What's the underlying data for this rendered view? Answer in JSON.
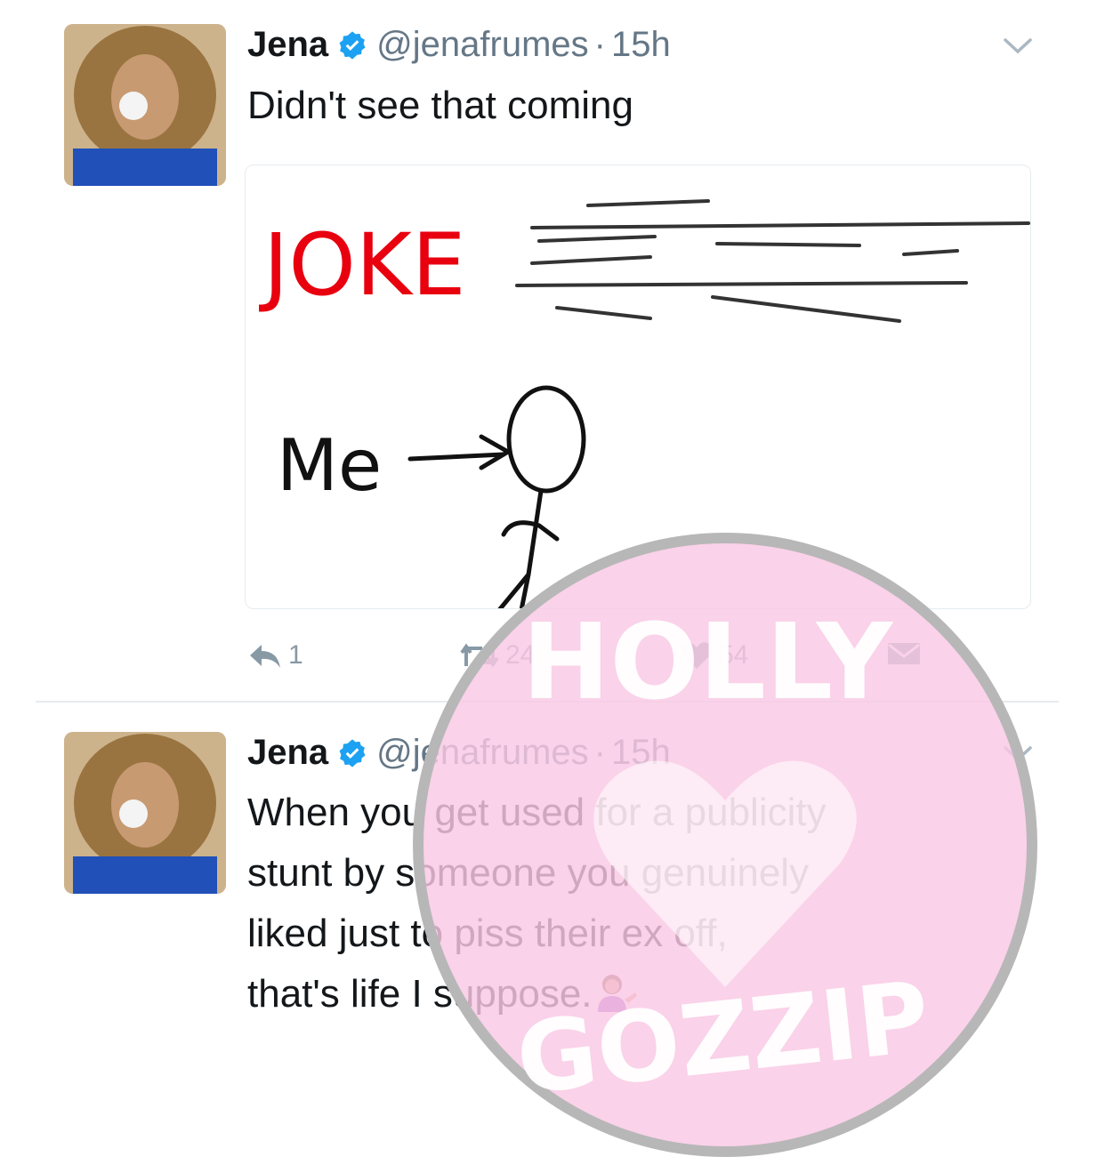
{
  "tweets": [
    {
      "name": "Jena",
      "handle": "@jenafrumes",
      "separator": "·",
      "time": "15h",
      "text": "Didn't see that coming",
      "image_text": {
        "joke": "JOKE",
        "me": "Me"
      },
      "actions": {
        "reply_count": "1",
        "retweet_count": "24",
        "like_count": "54"
      }
    },
    {
      "name": "Jena",
      "handle": "@jenafrumes",
      "separator": "·",
      "time": "15h",
      "text_lines": [
        "When you get used for a publicity",
        "stunt by someone you genuinely",
        "liked just to piss their ex off,",
        "that's life I suppose."
      ]
    }
  ],
  "watermark": {
    "top": "HOLLY",
    "bottom": "GOZZIP"
  },
  "colors": {
    "verified": "#1da1f2",
    "meta_gray": "#657786",
    "watermark_pink": "#f9c8e4",
    "joke_red": "#e8000f"
  }
}
